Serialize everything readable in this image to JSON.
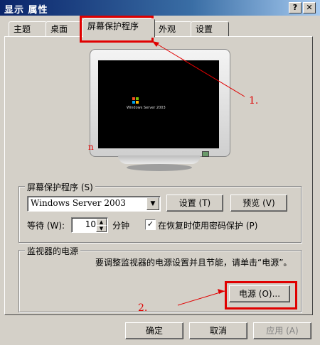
{
  "window": {
    "title": "显示 属性",
    "help_glyph": "?",
    "close_glyph": "✕"
  },
  "tabs": [
    {
      "label": "主题",
      "active": false
    },
    {
      "label": "桌面",
      "active": false
    },
    {
      "label": "屏幕保护程序",
      "active": true
    },
    {
      "label": "外观",
      "active": false
    },
    {
      "label": "设置",
      "active": false
    }
  ],
  "preview": {
    "logo_text": "Windows Server 2003"
  },
  "screensaver": {
    "group_label": "屏幕保护程序 (S)",
    "selected": "Windows Server 2003",
    "settings_button": "设置 (T)",
    "preview_button": "预览 (V)",
    "wait_label": "等待 (W):",
    "wait_value": "10",
    "minutes_label": "分钟",
    "password_checkbox_label": "在恢复时使用密码保护 (P)",
    "password_checked": true
  },
  "power": {
    "group_label": "监视器的电源",
    "description": "要调整监视器的电源设置并且节能，请单击“电源”。",
    "power_button": "电源 (O)..."
  },
  "footer": {
    "ok": "确定",
    "cancel": "取消",
    "apply": "应用 (A)"
  },
  "annotations": {
    "step1": "1.",
    "step2": "2.",
    "stray_mark": "n",
    "color": "#e00000"
  }
}
